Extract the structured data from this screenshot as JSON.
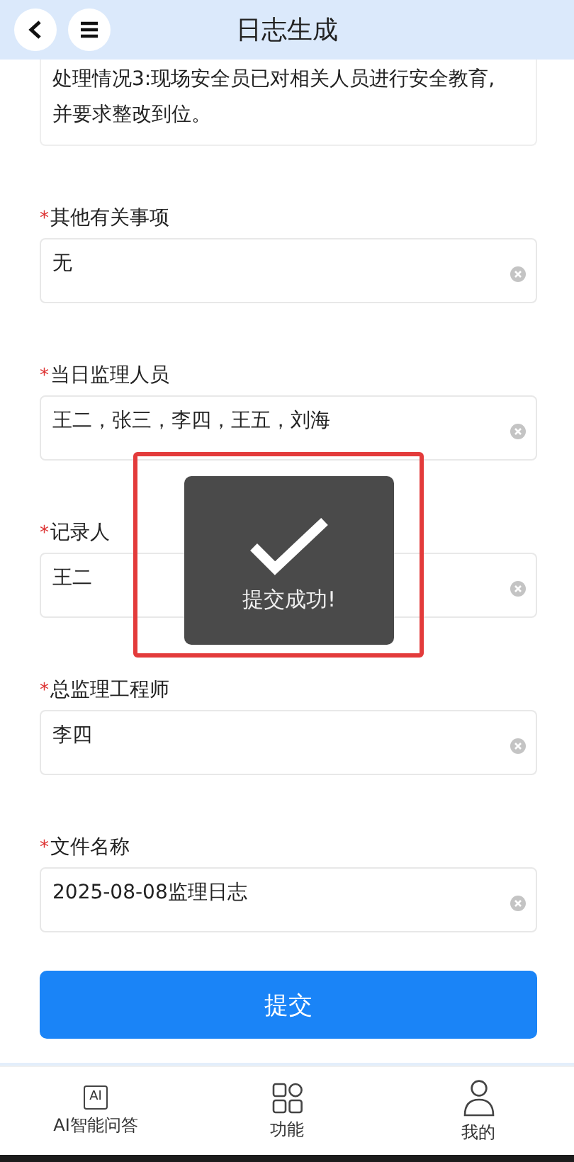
{
  "header": {
    "title": "日志生成"
  },
  "top_text": {
    "lines": [
      "处理情况3:现场安全员已对相关人员进行安全教育,",
      "并要求整改到位。"
    ]
  },
  "fields": [
    {
      "required_mark": "*",
      "label": "其他有关事项",
      "value": "无"
    },
    {
      "required_mark": "*",
      "label": "当日监理人员",
      "value": "王二，张三，李四，王五，刘海"
    },
    {
      "required_mark": "*",
      "label": "记录人",
      "value": "王二"
    },
    {
      "required_mark": "*",
      "label": "总监理工程师",
      "value": "李四"
    },
    {
      "required_mark": "*",
      "label": "文件名称",
      "value": "2025-08-08监理日志"
    }
  ],
  "submit_button": "提交",
  "toast": {
    "message": "提交成功!"
  },
  "tab_bar": [
    {
      "kind": "ai",
      "icon_text": "AI",
      "label": "AI智能问答"
    },
    {
      "kind": "grid",
      "label": "功能"
    },
    {
      "kind": "person",
      "label": "我的"
    }
  ]
}
